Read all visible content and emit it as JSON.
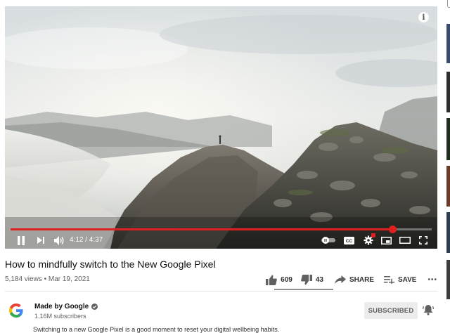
{
  "player": {
    "time_display": "4:12 / 4:37",
    "progress_fraction": 0.907,
    "info_label": "i",
    "controls": {
      "pause": "pause-icon",
      "next": "next-icon",
      "volume": "volume-icon",
      "autoplay": "autoplay-toggle",
      "captions": "CC",
      "settings": "gear-icon",
      "miniplayer": "miniplayer-icon",
      "theater": "theater-icon",
      "fullscreen": "fullscreen-icon"
    },
    "colors": {
      "progress": "#e01f1f"
    }
  },
  "video": {
    "title": "How to mindfully switch to the New Google Pixel",
    "views": "5,184 views",
    "date": "Mar 19, 2021",
    "separator": "•"
  },
  "actions": {
    "likes": "609",
    "dislikes": "43",
    "share": "SHARE",
    "save": "SAVE",
    "more": "•••"
  },
  "channel": {
    "name": "Made by Google",
    "subscribers": "1.16M subscribers",
    "subscribe_label": "SUBSCRIBED",
    "verified": "check-icon"
  },
  "description": {
    "preview": "Switching to a new Google Pixel is a good moment to reset your digital wellbeing habits."
  }
}
